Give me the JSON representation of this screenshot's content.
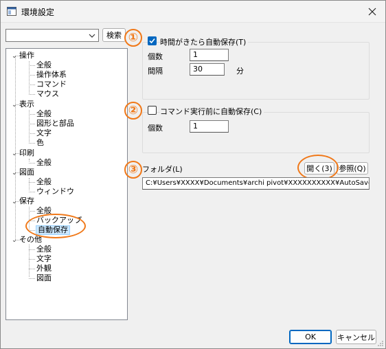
{
  "window": {
    "title": "環境設定"
  },
  "search": {
    "value": "",
    "button_label": "検索"
  },
  "tree": [
    {
      "label": "操作",
      "children": [
        "全般",
        "操作体系",
        "コマンド",
        "マウス"
      ]
    },
    {
      "label": "表示",
      "children": [
        "全般",
        "図形と部品",
        "文字",
        "色"
      ]
    },
    {
      "label": "印刷",
      "children": [
        "全般"
      ]
    },
    {
      "label": "図面",
      "children": [
        "全般",
        "ウィンドウ"
      ]
    },
    {
      "label": "保存",
      "children": [
        "全般",
        "バックアップ",
        "自動保存"
      ]
    },
    {
      "label": "その他",
      "children": [
        "全般",
        "文字",
        "外観",
        "図面"
      ]
    }
  ],
  "selected_item": "自動保存",
  "timed_save": {
    "badge": "①",
    "checkbox_label": "時間がきたら自動保存(T)",
    "checked": true,
    "count_label": "個数",
    "count_value": "1",
    "interval_label": "間隔",
    "interval_value": "30",
    "interval_unit": "分"
  },
  "command_save": {
    "badge": "②",
    "checkbox_label": "コマンド実行前に自動保存(C)",
    "checked": false,
    "count_label": "個数",
    "count_value": "1"
  },
  "folder": {
    "badge": "③",
    "label": "フォルダ(L)",
    "open_button": "開く(3)",
    "browse_button": "参照(Q)",
    "path": "C:¥Users¥XXXX¥Documents¥archi pivot¥XXXXXXXXXX¥AutoSave"
  },
  "footer": {
    "ok_label": "OK",
    "cancel_label": "キャンセル"
  },
  "colors": {
    "annotation": "#f07818",
    "accent": "#0067c0",
    "selection": "#cce8ff"
  }
}
